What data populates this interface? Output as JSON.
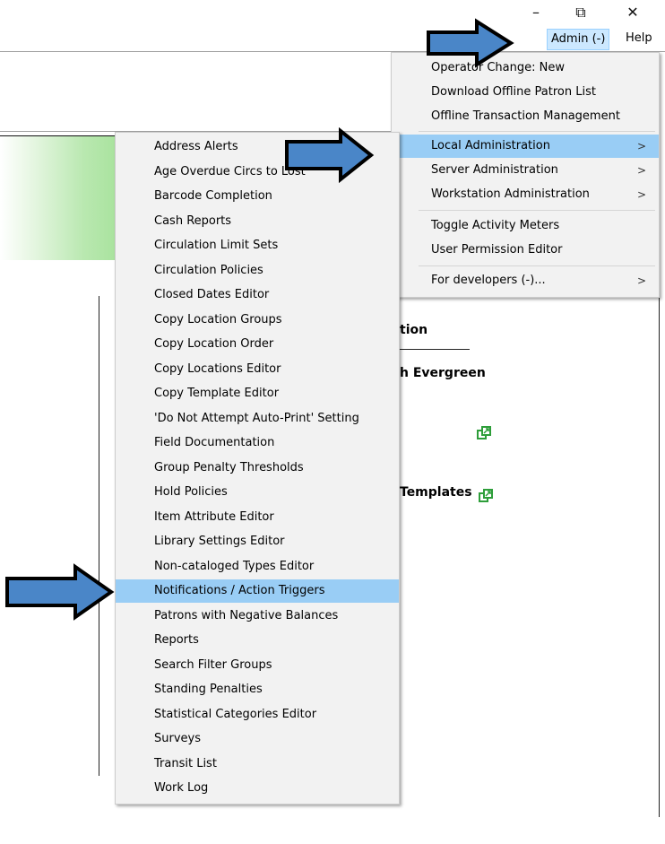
{
  "window_controls": {
    "minimize": "–",
    "restore": "⧉",
    "close": "✕"
  },
  "menubar": {
    "admin_label": "Admin (-)",
    "help_label": "Help"
  },
  "admin_menu": {
    "items": [
      {
        "label": "Operator Change: New"
      },
      {
        "label": "Download Offline Patron List"
      },
      {
        "label": "Offline Transaction Management"
      },
      {
        "label": "Local Administration",
        "arrow": ">"
      },
      {
        "label": "Server Administration",
        "arrow": ">"
      },
      {
        "label": "Workstation Administration",
        "arrow": ">"
      },
      {
        "label": "Toggle Activity Meters"
      },
      {
        "label": "User Permission Editor"
      },
      {
        "label": "For developers (-)...",
        "arrow": ">"
      }
    ]
  },
  "local_admin_menu": {
    "items": [
      {
        "label": "Address Alerts"
      },
      {
        "label": "Age Overdue Circs to Lost"
      },
      {
        "label": "Barcode Completion"
      },
      {
        "label": "Cash Reports"
      },
      {
        "label": "Circulation Limit Sets"
      },
      {
        "label": "Circulation Policies"
      },
      {
        "label": "Closed Dates Editor"
      },
      {
        "label": "Copy Location Groups"
      },
      {
        "label": "Copy Location Order"
      },
      {
        "label": "Copy Locations Editor"
      },
      {
        "label": "Copy Template Editor"
      },
      {
        "label": "'Do Not Attempt Auto-Print' Setting"
      },
      {
        "label": "Field Documentation"
      },
      {
        "label": "Group Penalty Thresholds"
      },
      {
        "label": "Hold Policies"
      },
      {
        "label": "Item Attribute Editor"
      },
      {
        "label": "Library Settings Editor"
      },
      {
        "label": "Non-cataloged Types Editor"
      },
      {
        "label": "Notifications / Action Triggers"
      },
      {
        "label": "Patrons with Negative Balances"
      },
      {
        "label": "Reports"
      },
      {
        "label": "Search Filter Groups"
      },
      {
        "label": "Standing Penalties"
      },
      {
        "label": "Statistical Categories Editor"
      },
      {
        "label": "Surveys"
      },
      {
        "label": "Transit List"
      },
      {
        "label": "Work Log"
      }
    ]
  },
  "background": {
    "heading_fragment": "tion",
    "evergreen_fragment": "h Evergreen",
    "templates_fragment": "Templates"
  },
  "colors": {
    "highlight": "#99cdf5",
    "arrow_fill": "#4a86c8",
    "menu_bg": "#f2f2f2",
    "icon_green": "#2e9e3a"
  }
}
